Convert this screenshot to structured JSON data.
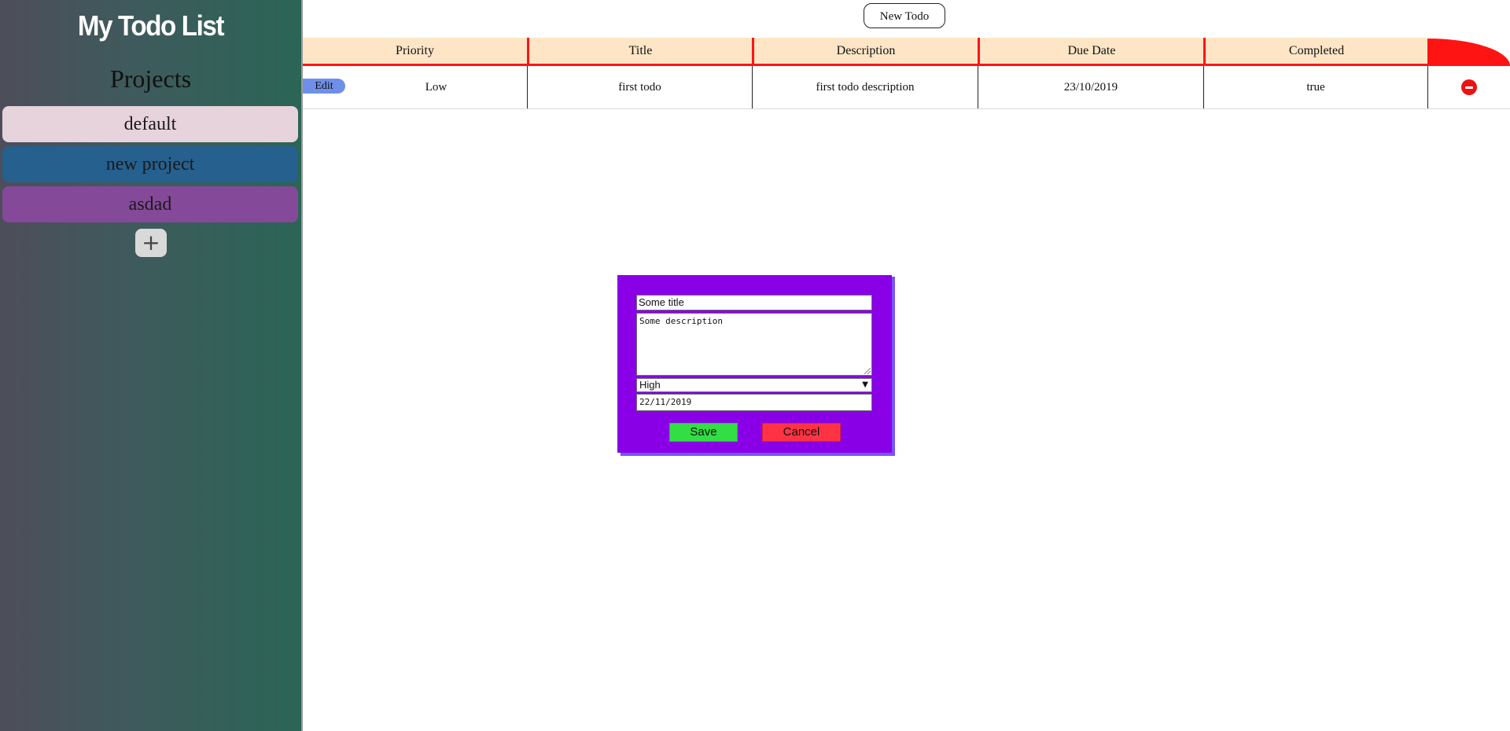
{
  "sidebar": {
    "app_title": "My Todo List",
    "projects_heading": "Projects",
    "projects": [
      {
        "label": "default",
        "color": "#e7d3dc"
      },
      {
        "label": "new project",
        "color": "#26608e"
      },
      {
        "label": "asdad",
        "color": "#844998"
      }
    ],
    "add_project_label": "+"
  },
  "toolbar": {
    "new_todo_label": "New Todo"
  },
  "table": {
    "columns": [
      "Priority",
      "Title",
      "Description",
      "Due Date",
      "Completed"
    ],
    "rows": [
      {
        "edit_label": "Edit",
        "priority": "Low",
        "title": "first todo",
        "description": "first todo description",
        "due_date": "23/10/2019",
        "completed": "true",
        "delete_icon": "minus-circle-icon"
      }
    ]
  },
  "form": {
    "title_value": "Some title",
    "description_value": "Some description",
    "priority_value": "High",
    "due_date_value": "22/11/2019",
    "save_label": "Save",
    "cancel_label": "Cancel"
  },
  "colors": {
    "header_accent": "#ff1414",
    "header_bg": "#fde5c6",
    "modal_bg": "#8a00e6",
    "save": "#33dd44",
    "cancel": "#ff3344"
  }
}
